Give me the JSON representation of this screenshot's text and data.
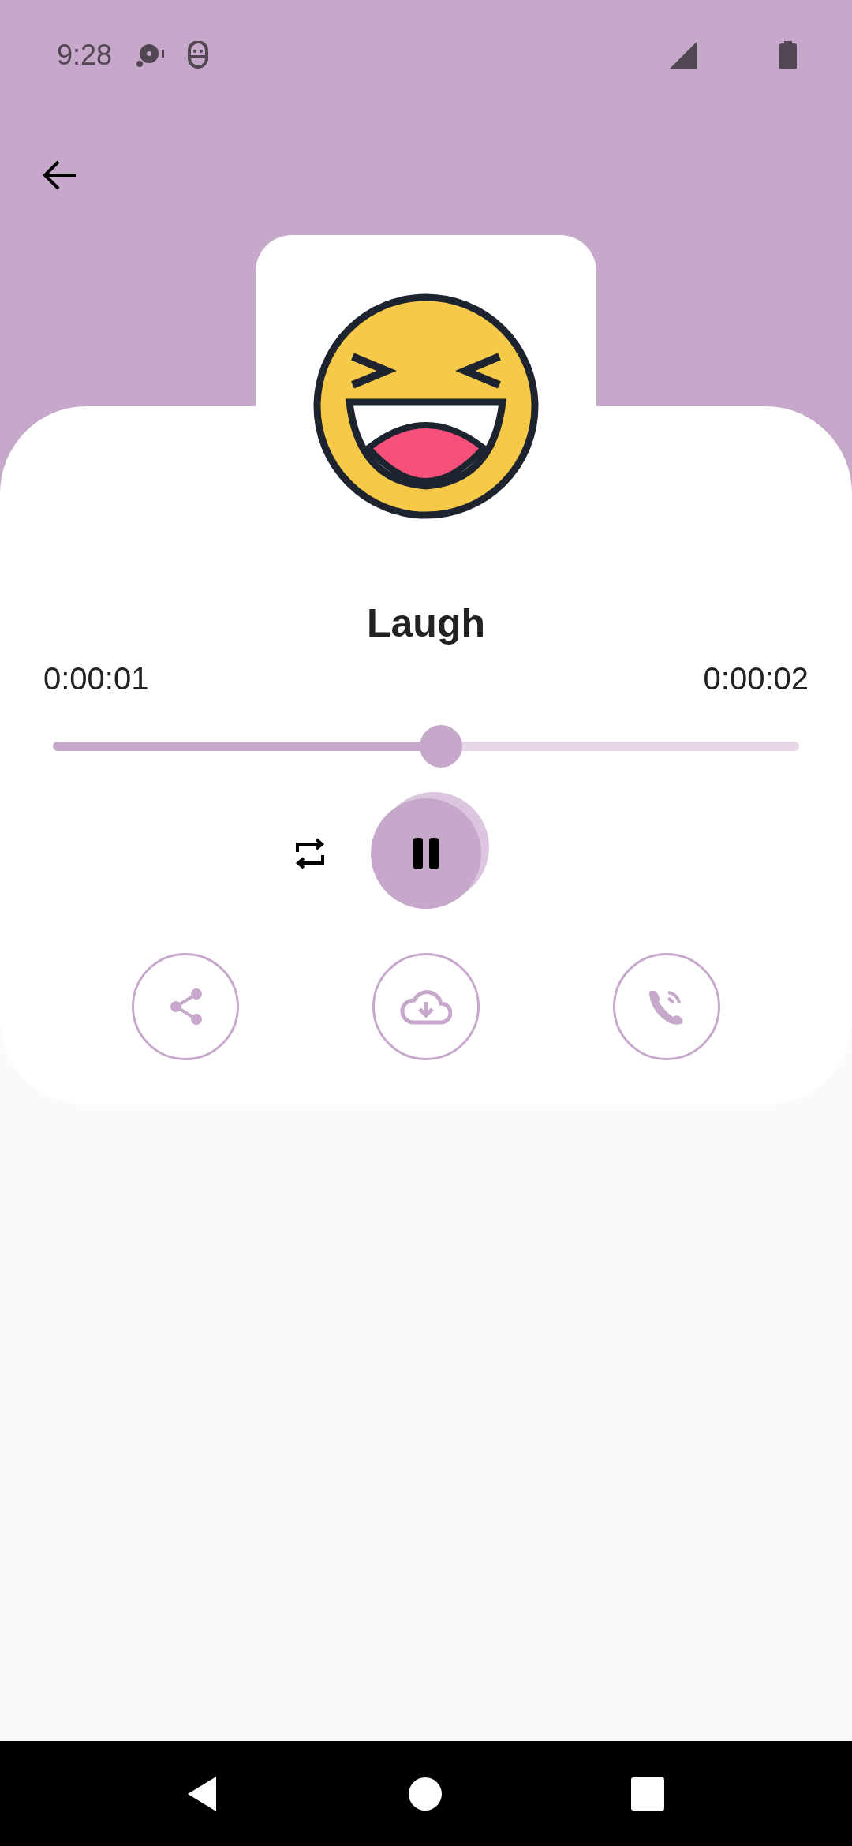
{
  "status_bar": {
    "time": "9:28"
  },
  "sound": {
    "title": "Laugh",
    "elapsed": "0:00:01",
    "duration": "0:00:02"
  },
  "progress": {
    "level": 0.52
  },
  "player": {
    "playing": true,
    "repeat": true
  },
  "actions": [
    {
      "kind": "share"
    },
    {
      "kind": "download"
    },
    {
      "kind": "call"
    }
  ]
}
